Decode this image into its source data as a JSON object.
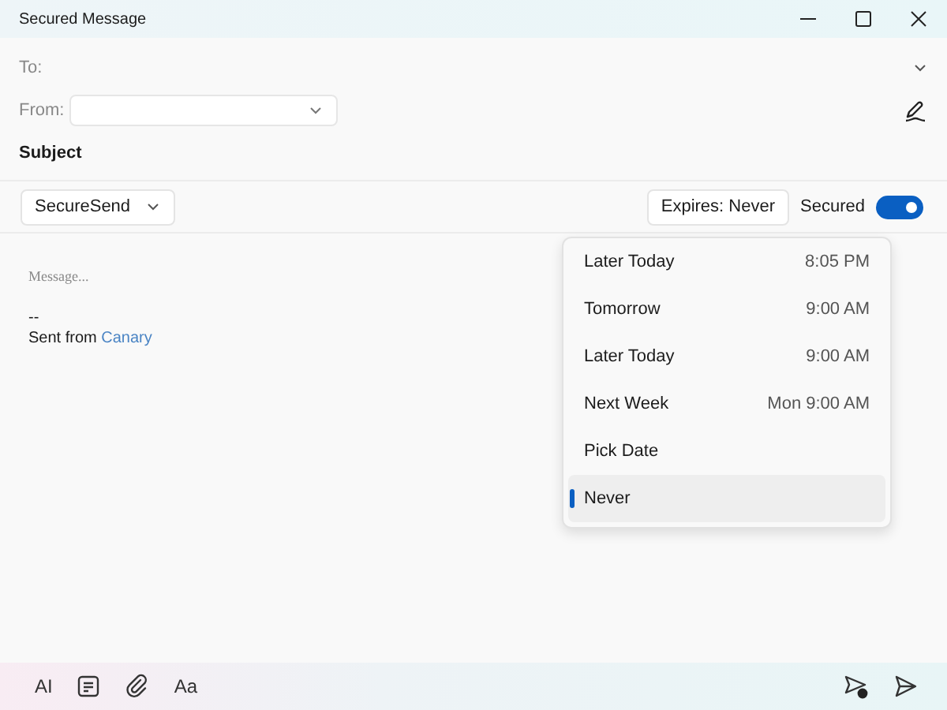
{
  "window": {
    "title": "Secured Message"
  },
  "to": {
    "label": "To:"
  },
  "from": {
    "label": "From:"
  },
  "subject": {
    "placeholder": "Subject"
  },
  "account": {
    "value": "SecureSend"
  },
  "expires": {
    "label": "Expires: Never"
  },
  "secured": {
    "label": "Secured",
    "on": true
  },
  "message": {
    "placeholder": "Message...",
    "separator": "--",
    "signature": "Sent from ",
    "link": "Canary"
  },
  "expiry_menu": [
    {
      "label": "Later Today",
      "time": "8:05 PM",
      "selected": false
    },
    {
      "label": "Tomorrow",
      "time": "9:00 AM",
      "selected": false
    },
    {
      "label": "Later Today",
      "time": "9:00 AM",
      "selected": false
    },
    {
      "label": "Next Week",
      "time": "Mon 9:00 AM",
      "selected": false
    },
    {
      "label": "Pick Date",
      "selected": false
    },
    {
      "label": "Never",
      "selected": true
    }
  ],
  "toolbar": {
    "ai": "AI",
    "format": "Aa"
  }
}
